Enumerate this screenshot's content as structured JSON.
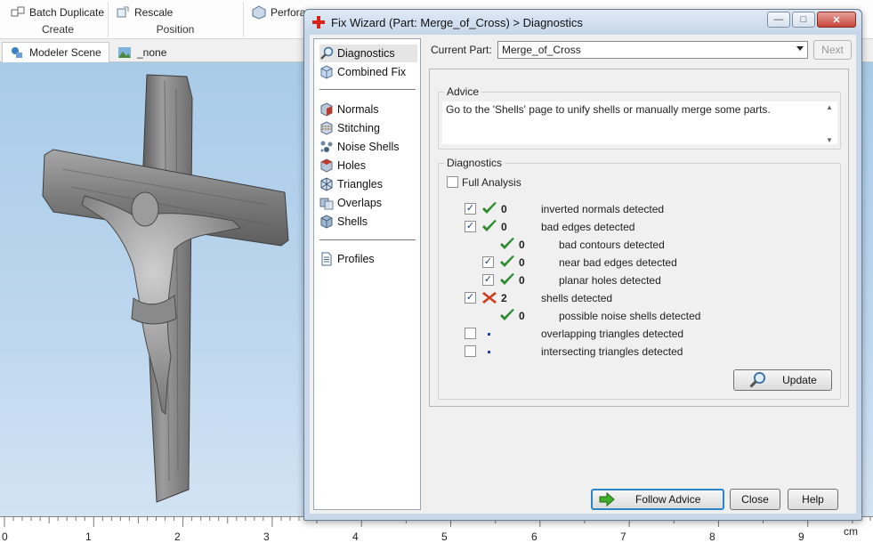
{
  "ribbon": {
    "batch_duplicate": "Batch Duplicate",
    "rescale": "Rescale",
    "perforate": "Perfora",
    "group_create": "Create",
    "group_position": "Position"
  },
  "tabs": {
    "modeler_scene": "Modeler Scene",
    "none": "_none"
  },
  "ruler": {
    "ticks": [
      "0",
      "1",
      "2",
      "3",
      "4",
      "5",
      "6",
      "7",
      "8",
      "9"
    ],
    "unit": "cm"
  },
  "dialog": {
    "title": "Fix Wizard (Part: Merge_of_Cross) > Diagnostics",
    "nav": {
      "diagnostics": "Diagnostics",
      "combined_fix": "Combined Fix",
      "normals": "Normals",
      "stitching": "Stitching",
      "noise_shells": "Noise Shells",
      "holes": "Holes",
      "triangles": "Triangles",
      "overlaps": "Overlaps",
      "shells": "Shells",
      "profiles": "Profiles"
    },
    "current_part_label": "Current Part:",
    "current_part_value": "Merge_of_Cross",
    "next_label": "Next",
    "advice_title": "Advice",
    "advice_text": "Go to the 'Shells' page to unify shells or manually merge some parts.",
    "diagnostics_title": "Diagnostics",
    "full_analysis_label": "Full Analysis",
    "rows": [
      {
        "checked": true,
        "status": "ok",
        "count": "0",
        "label": "inverted normals detected"
      },
      {
        "checked": true,
        "status": "ok",
        "count": "0",
        "label": "bad edges detected"
      },
      {
        "checked": null,
        "status": "ok",
        "count": "0",
        "label": "bad contours detected"
      },
      {
        "checked": true,
        "status": "ok",
        "count": "0",
        "label": "near bad edges detected"
      },
      {
        "checked": true,
        "status": "ok",
        "count": "0",
        "label": "planar holes detected"
      },
      {
        "checked": true,
        "status": "error",
        "count": "2",
        "label": "shells detected"
      },
      {
        "checked": null,
        "status": "ok",
        "count": "0",
        "label": "possible noise shells detected"
      },
      {
        "checked": false,
        "status": "pending",
        "count": "",
        "label": "overlapping triangles detected"
      },
      {
        "checked": false,
        "status": "pending",
        "count": "",
        "label": "intersecting triangles detected"
      }
    ],
    "update_label": "Update",
    "follow_advice_label": "Follow Advice",
    "close_label": "Close",
    "help_label": "Help"
  },
  "colors": {
    "ok_check": "#2e8b2e",
    "error_x": "#d23a1e",
    "viewport_sky": "#b5d2ec",
    "follow_border": "#2a86c8"
  }
}
